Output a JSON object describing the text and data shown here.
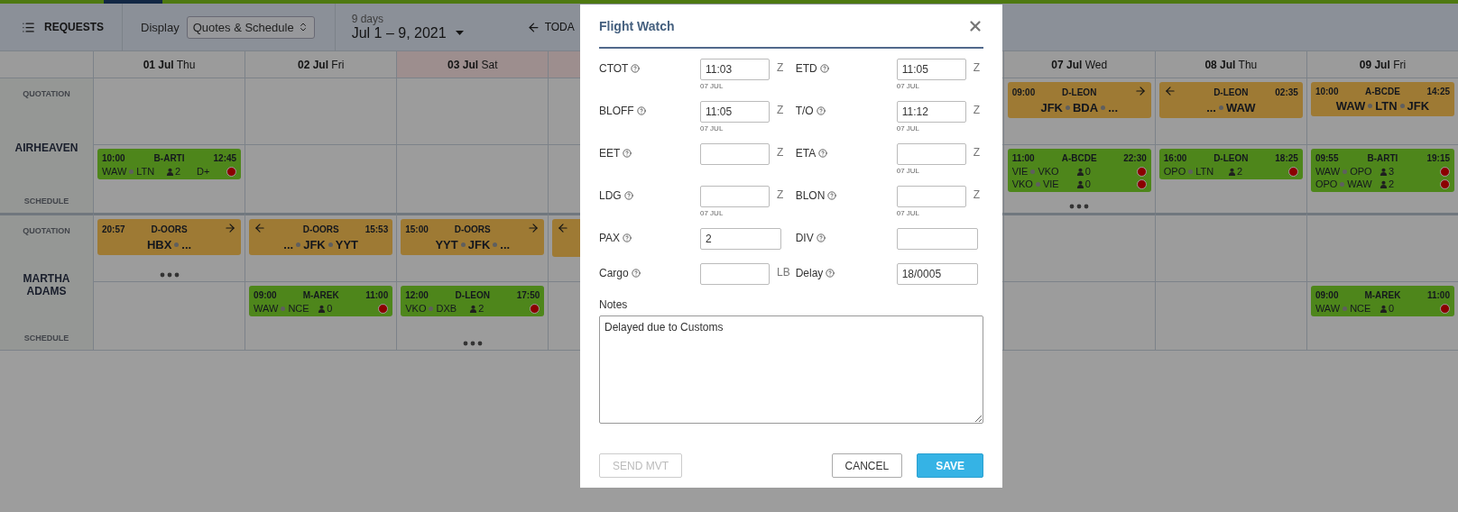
{
  "toolbar": {
    "requests": "REQUESTS",
    "display_label": "Display",
    "display_value": "Quotes & Schedule",
    "range_caption": "9 days",
    "range": "Jul 1 – 9, 2021",
    "today": "TODA"
  },
  "days": [
    {
      "date": "01 Jul",
      "weekday": "Thu",
      "weekend": false
    },
    {
      "date": "02 Jul",
      "weekday": "Fri",
      "weekend": false
    },
    {
      "date": "03 Jul",
      "weekday": "Sat",
      "weekend": true
    },
    {
      "weekend": true
    },
    {
      "date": "07 Jul",
      "weekday": "Wed",
      "weekend": false
    },
    {
      "date": "08 Jul",
      "weekday": "Thu",
      "weekend": false
    },
    {
      "date": "09 Jul",
      "weekday": "Fri",
      "weekend": false
    }
  ],
  "resources": [
    {
      "name": "AIRHEAVEN",
      "rows": [
        {
          "kind": "quotation",
          "label": "QUOTATION",
          "cells": [
            {
              "more": false
            },
            {
              "more": false
            },
            {
              "more": false
            },
            {
              "more": false
            },
            {
              "more": false,
              "cards": [
                {
                  "start": "09:00",
                  "reg": "D-LEON",
                  "continues_before": false,
                  "continues_after": true,
                  "route": [
                    "JFK",
                    "BDA",
                    "..."
                  ]
                }
              ]
            },
            {
              "more": false,
              "cards": [
                {
                  "reg": "D-LEON",
                  "end": "02:35",
                  "continues_before": true,
                  "continues_after": false,
                  "route": [
                    "...",
                    "WAW"
                  ]
                }
              ]
            },
            {
              "more": false,
              "cards": [
                {
                  "start": "10:00",
                  "reg": "A-BCDE",
                  "end": "14:25",
                  "continues_before": false,
                  "continues_after": false,
                  "route": [
                    "WAW",
                    "LTN",
                    "JFK"
                  ]
                }
              ]
            }
          ]
        },
        {
          "kind": "schedule",
          "label": "SCHEDULE",
          "cells": [
            {
              "more": false,
              "cards": [
                {
                  "start": "10:00",
                  "reg": "B-ARTI",
                  "end": "12:45",
                  "legs": [
                    {
                      "route": [
                        "WAW",
                        "LTN"
                      ],
                      "pax": "2",
                      "extra": "D+",
                      "alert": true
                    }
                  ]
                }
              ]
            },
            {
              "more": false
            },
            {
              "more": false
            },
            {
              "more": false
            },
            {
              "more": true,
              "cards": [
                {
                  "start": "11:00",
                  "reg": "A-BCDE",
                  "end": "22:30",
                  "legs": [
                    {
                      "route": [
                        "VIE",
                        "VKO"
                      ],
                      "pax": "0",
                      "alert": true
                    },
                    {
                      "route": [
                        "VKO",
                        "VIE"
                      ],
                      "pax": "0",
                      "alert": true
                    }
                  ]
                }
              ]
            },
            {
              "more": false,
              "cards": [
                {
                  "start": "16:00",
                  "reg": "D-LEON",
                  "end": "18:25",
                  "legs": [
                    {
                      "route": [
                        "OPO",
                        "LTN"
                      ],
                      "pax": "2",
                      "alert": true
                    }
                  ]
                }
              ]
            },
            {
              "more": false,
              "cards": [
                {
                  "start": "09:55",
                  "reg": "B-ARTI",
                  "end": "19:15",
                  "legs": [
                    {
                      "route": [
                        "WAW",
                        "OPO"
                      ],
                      "pax": "3",
                      "alert": true
                    },
                    {
                      "route": [
                        "OPO",
                        "WAW"
                      ],
                      "pax": "2",
                      "alert": true
                    }
                  ]
                }
              ]
            }
          ]
        }
      ]
    },
    {
      "name": "MARTHA ADAMS",
      "rows": [
        {
          "kind": "quotation",
          "label": "QUOTATION",
          "cells": [
            {
              "more": true,
              "cards": [
                {
                  "start": "20:57",
                  "reg": "D-OORS",
                  "continues_before": false,
                  "continues_after": true,
                  "route": [
                    "HBX",
                    "..."
                  ]
                }
              ]
            },
            {
              "more": false,
              "cards": [
                {
                  "reg": "D-OORS",
                  "end": "15:53",
                  "continues_before": true,
                  "continues_after": false,
                  "route": [
                    "...",
                    "JFK",
                    "YYT"
                  ]
                }
              ]
            },
            {
              "more": false,
              "cards": [
                {
                  "start": "15:00",
                  "reg": "D-OORS",
                  "continues_before": false,
                  "continues_after": true,
                  "route": [
                    "YYT",
                    "JFK",
                    "..."
                  ]
                }
              ]
            },
            {
              "more": false,
              "cards": [
                {
                  "continues_before": true,
                  "continues_after": false
                }
              ]
            },
            {
              "more": false
            },
            {
              "more": false
            },
            {
              "more": false
            }
          ]
        },
        {
          "kind": "schedule",
          "label": "SCHEDULE",
          "cells": [
            {
              "more": false
            },
            {
              "more": false,
              "cards": [
                {
                  "start": "09:00",
                  "reg": "M-AREK",
                  "end": "11:00",
                  "legs": [
                    {
                      "route": [
                        "WAW",
                        "NCE"
                      ],
                      "pax": "0",
                      "alert": true
                    }
                  ]
                }
              ]
            },
            {
              "more": true,
              "cards": [
                {
                  "start": "12:00",
                  "reg": "D-LEON",
                  "end": "17:50",
                  "legs": [
                    {
                      "route": [
                        "VKO",
                        "DXB"
                      ],
                      "pax": "2",
                      "alert": true
                    }
                  ]
                }
              ]
            },
            {
              "more": false
            },
            {
              "more": false
            },
            {
              "more": false
            },
            {
              "more": false,
              "cards": [
                {
                  "start": "09:00",
                  "reg": "M-AREK",
                  "end": "11:00",
                  "legs": [
                    {
                      "route": [
                        "WAW",
                        "NCE"
                      ],
                      "pax": "0",
                      "alert": true
                    }
                  ]
                }
              ]
            }
          ]
        }
      ]
    }
  ],
  "dialog": {
    "title": "Flight Watch",
    "fields": [
      {
        "label": "CTOT",
        "help": true,
        "value": "11:03",
        "unit": "Z",
        "date": "07 JUL"
      },
      {
        "label": "ETD",
        "help": true,
        "value": "11:05",
        "unit": "Z",
        "date": "07 JUL"
      },
      {
        "label": "BLOFF",
        "help": true,
        "value": "11:05",
        "unit": "Z",
        "date": "07 JUL"
      },
      {
        "label": "T/O",
        "help": true,
        "value": "11:12",
        "unit": "Z",
        "date": "07 JUL"
      },
      {
        "label": "EET",
        "help": true,
        "unit": "Z"
      },
      {
        "label": "ETA",
        "help": true,
        "unit": "Z",
        "date": "07 JUL"
      },
      {
        "label": "LDG",
        "help": true,
        "unit": "Z",
        "date": "07 JUL"
      },
      {
        "label": "BLON",
        "help": true,
        "unit": "Z",
        "date": "07 JUL"
      },
      {
        "label": "PAX",
        "help": true,
        "value": "2"
      },
      {
        "label": "DIV",
        "help": true
      },
      {
        "label": "Cargo",
        "help": true,
        "unit": "LB"
      },
      {
        "label": "Delay",
        "help": true,
        "value": "18/0005"
      }
    ],
    "notes_label": "Notes",
    "notes": "Delayed due to Customs",
    "buttons": [
      {
        "label": "SEND MVT",
        "kind": "secondary",
        "disabled": true
      },
      {
        "label": "CANCEL",
        "kind": "secondary",
        "disabled": false
      },
      {
        "label": "SAVE",
        "kind": "primary",
        "disabled": false
      }
    ]
  }
}
